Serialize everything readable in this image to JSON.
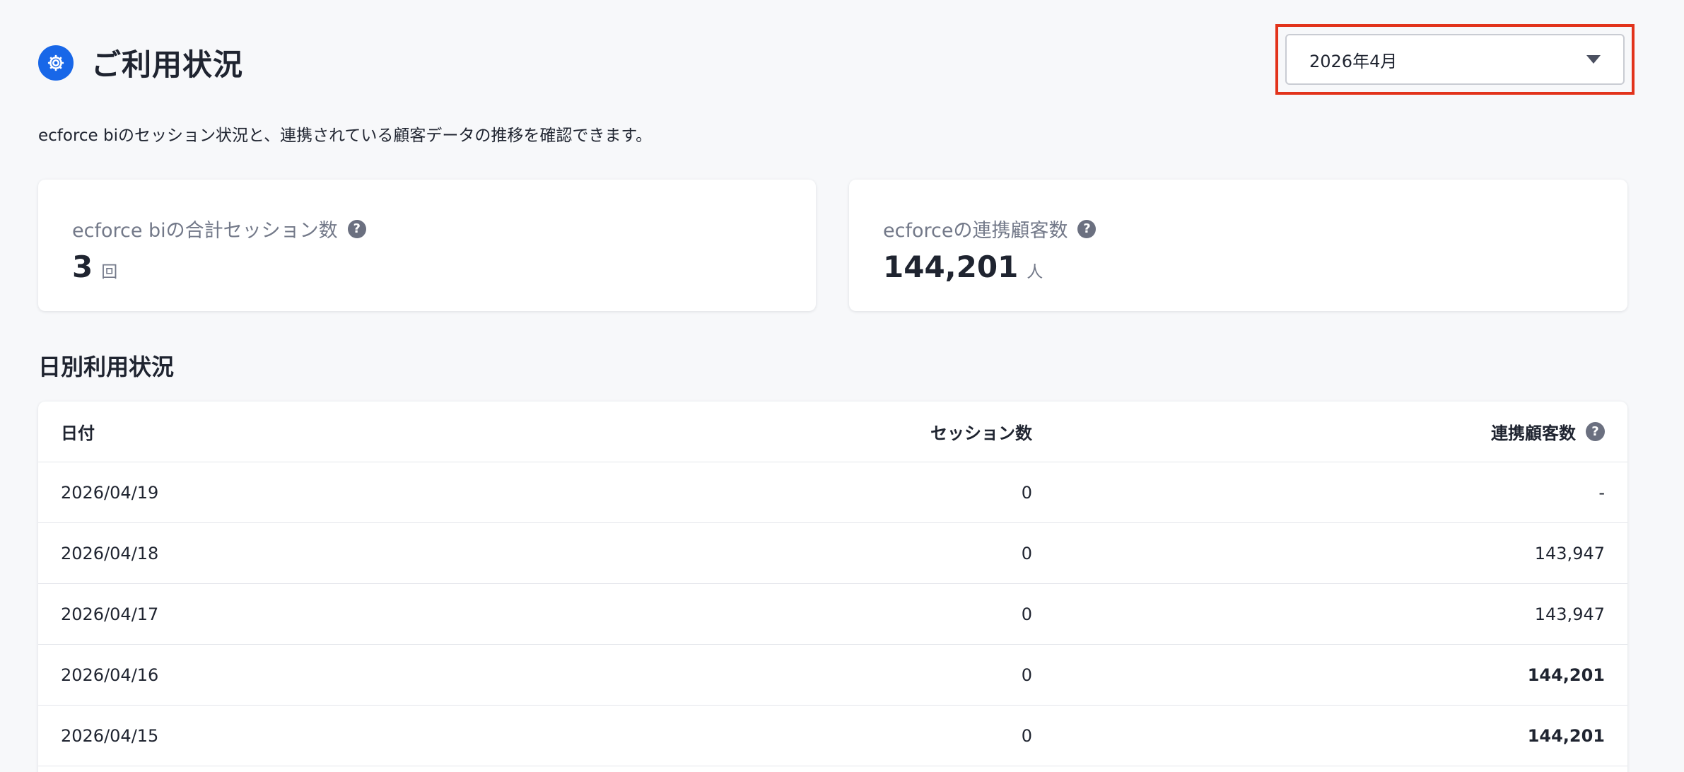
{
  "header": {
    "title": "ご利用状況",
    "icon": "gear-icon",
    "accent_color": "#1867e8"
  },
  "month_select": {
    "value": "2026年4月",
    "highlight_color": "#e2331b"
  },
  "description": "ecforce biのセッション状況と、連携されている顧客データの推移を確認できます。",
  "stats": {
    "sessions": {
      "label": "ecforce biの合計セッション数",
      "value": "3",
      "unit": "回"
    },
    "customers": {
      "label": "ecforceの連携顧客数",
      "value": "144,201",
      "unit": "人"
    }
  },
  "daily": {
    "title": "日別利用状況",
    "columns": {
      "date": "日付",
      "sessions": "セッション数",
      "customers": "連携顧客数"
    },
    "rows": [
      {
        "date": "2026/04/19",
        "sessions": "0",
        "customers": "-"
      },
      {
        "date": "2026/04/18",
        "sessions": "0",
        "customers": "143,947"
      },
      {
        "date": "2026/04/17",
        "sessions": "0",
        "customers": "143,947"
      },
      {
        "date": "2026/04/16",
        "sessions": "0",
        "customers": "144,201"
      },
      {
        "date": "2026/04/15",
        "sessions": "0",
        "customers": "144,201"
      }
    ]
  },
  "help_glyph": "?"
}
